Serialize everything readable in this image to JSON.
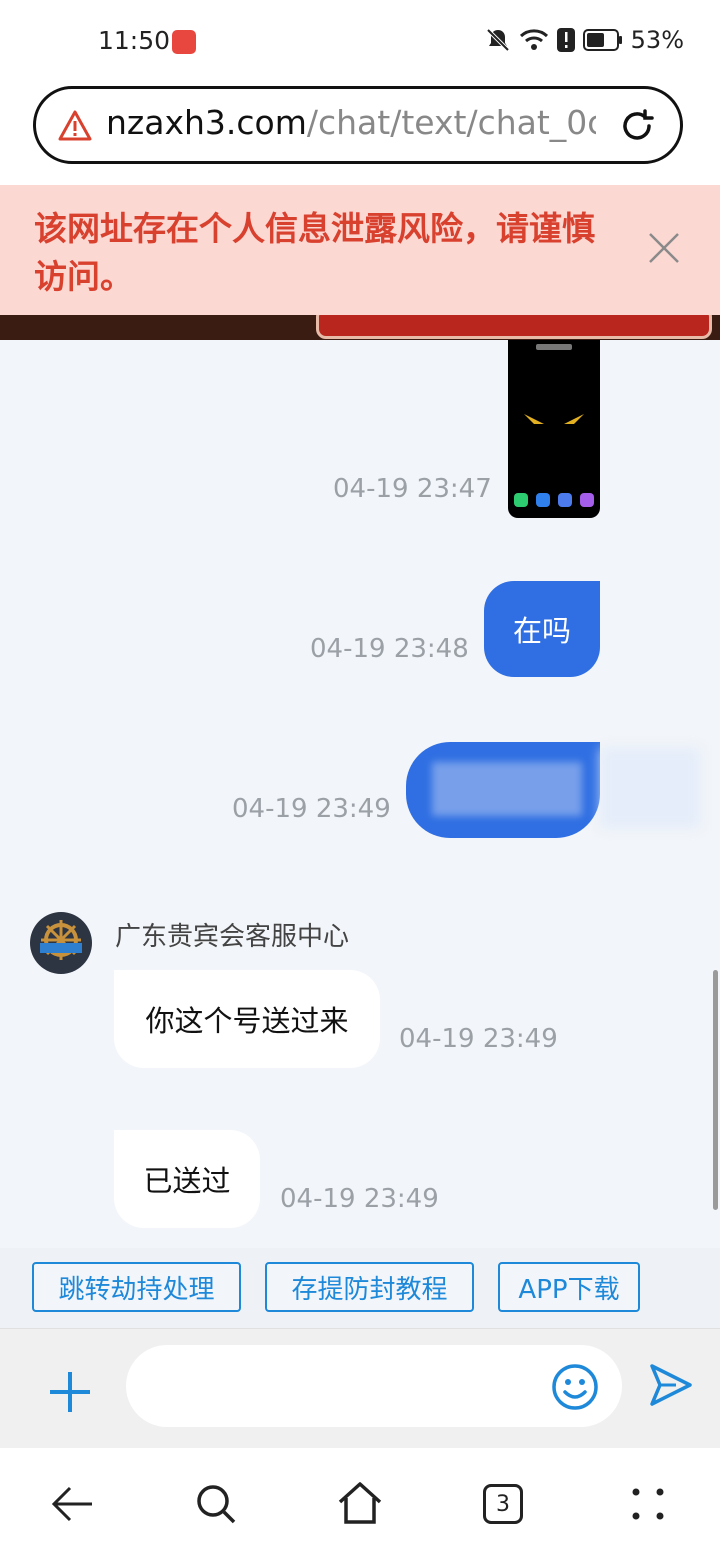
{
  "status_bar": {
    "time": "11:50",
    "battery": "53%",
    "icons": [
      "notification-bell-off-icon",
      "wifi-icon",
      "alert-icon",
      "battery-icon"
    ]
  },
  "browser": {
    "url_domain": "nzaxh3.com",
    "url_path": "/chat/text/chat_0c",
    "security_warning": "该网址存在个人信息泄露风险，请谨慎访问。",
    "tab_count": "3"
  },
  "chat": {
    "messages": [
      {
        "from": "me",
        "type": "image",
        "time": "04-19 23:47"
      },
      {
        "from": "me",
        "type": "text",
        "text": "在吗",
        "time": "04-19 23:48"
      },
      {
        "from": "me",
        "type": "text",
        "text": "",
        "blurred": true,
        "time": "04-19 23:49"
      },
      {
        "from": "agent",
        "sender": "广东贵宾会客服中心",
        "type": "text",
        "text": "你这个号送过来",
        "time": "04-19 23:49"
      },
      {
        "from": "agent",
        "type": "text",
        "text": "已送过",
        "time": "04-19 23:49"
      }
    ]
  },
  "quick_actions": [
    "跳转劫持处理",
    "存提防封教程",
    "APP下载"
  ],
  "input": {
    "placeholder": ""
  },
  "colors": {
    "accent": "#2f6fe3",
    "quick_button": "#1e88d9",
    "warning_bg": "#fcd8d3",
    "warning_text": "#d9412f",
    "chat_bg": "#f2f5f9"
  }
}
